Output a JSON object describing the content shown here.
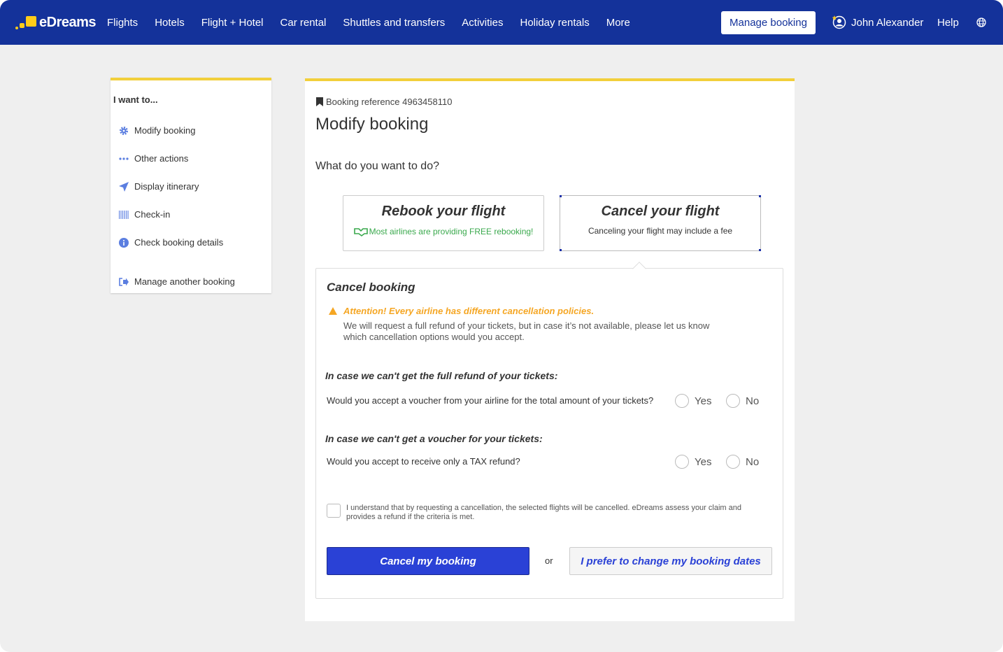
{
  "header": {
    "brand": "eDreams",
    "nav": [
      "Flights",
      "Hotels",
      "Flight + Hotel",
      "Car rental",
      "Shuttles and transfers",
      "Activities",
      "Holiday rentals",
      "More"
    ],
    "manage_booking": "Manage booking",
    "user_name": "John Alexander",
    "help": "Help",
    "colors": {
      "bar": "#14329a",
      "logo": "#ffcc19"
    }
  },
  "sidebar": {
    "title": "I want to...",
    "items": [
      {
        "label": "Modify booking",
        "icon": "gear-icon"
      },
      {
        "label": "Other actions",
        "icon": "dots-icon"
      },
      {
        "label": "Display itinerary",
        "icon": "plane-icon"
      },
      {
        "label": "Check-in",
        "icon": "barcode-icon"
      },
      {
        "label": "Check booking details",
        "icon": "info-icon"
      },
      {
        "label": "Manage another booking",
        "icon": "exit-icon"
      }
    ]
  },
  "main": {
    "booking_reference": "Booking reference 4963458110",
    "title": "Modify booking",
    "question": "What do you want to do?",
    "options": {
      "rebook": {
        "title": "Rebook your flight",
        "subtitle": "Most airlines are providing FREE rebooking!"
      },
      "cancel": {
        "title": "Cancel your flight",
        "subtitle": "Canceling your flight may include a fee"
      }
    },
    "panel": {
      "title": "Cancel booking",
      "warning_title": "Attention! Every airline has different cancellation policies.",
      "warning_text": "We will request a full refund of your tickets, but in case it’s not available, please let us know which cancellation options would you accept.",
      "section1": {
        "heading": "In case we can't get the full refund of your tickets:",
        "question": "Would you accept a voucher from your airline for the total amount of your tickets?",
        "yes": "Yes",
        "no": "No"
      },
      "section2": {
        "heading": "In case we can't get a voucher for your tickets:",
        "question": "Would you accept to receive only a TAX refund?",
        "yes": "Yes",
        "no": "No"
      },
      "consent": "I understand that by requesting a cancellation, the selected flights will be cancelled. eDreams assess your claim and provides a refund if the criteria is met.",
      "primary_button": "Cancel my booking",
      "or": "or",
      "secondary_button": "I prefer to change my booking dates"
    }
  }
}
